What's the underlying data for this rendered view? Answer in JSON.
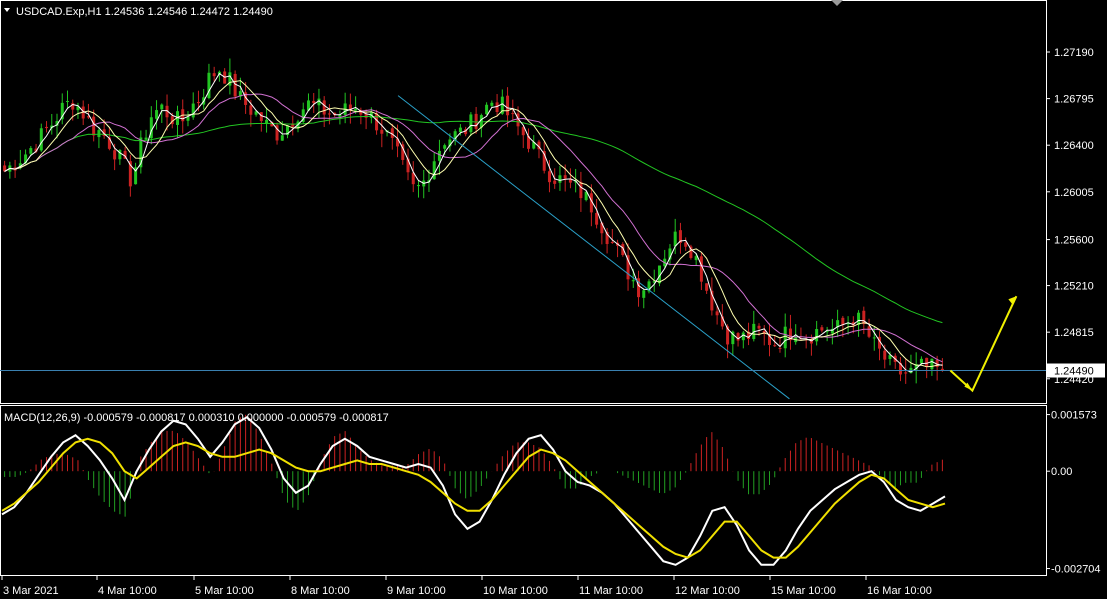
{
  "header": {
    "symbol_line": "USDCAD.Exp,H1  1.24536 1.24546 1.24472 1.24490"
  },
  "macd": {
    "label": "MACD(12,26,9) -0.000579 -0.000817 0.000310 0.000000 -0.000579 -0.000817"
  },
  "chart_data": [
    {
      "type": "candlestick",
      "title": "USDCAD.Exp,H1",
      "ohlc_current": {
        "open": 1.24536,
        "high": 1.24546,
        "low": 1.24472,
        "close": 1.2449
      },
      "y_ticks": [
        "1.27190",
        "1.26795",
        "1.26400",
        "1.26005",
        "1.25600",
        "1.25210",
        "1.24815",
        "1.24420"
      ],
      "y_tick_values": [
        1.2719,
        1.26795,
        1.264,
        1.26005,
        1.256,
        1.2521,
        1.24815,
        1.2442
      ],
      "ylim": [
        1.2424,
        1.2758
      ],
      "current_price_label": "1.24490",
      "current_price": 1.2449,
      "x_ticks": [
        "3 Mar 2021",
        "4 Mar 10:00",
        "5 Mar 10:00",
        "8 Mar 10:00",
        "9 Mar 10:00",
        "10 Mar 10:00",
        "11 Mar 10:00",
        "12 Mar 10:00",
        "15 Mar 10:00",
        "16 Mar 10:00"
      ],
      "close_path": [
        1.2618,
        1.2625,
        1.2632,
        1.264,
        1.265,
        1.266,
        1.2672,
        1.2678,
        1.2668,
        1.2655,
        1.265,
        1.264,
        1.2625,
        1.261,
        1.264,
        1.2665,
        1.2672,
        1.2665,
        1.2658,
        1.2672,
        1.268,
        1.2698,
        1.2705,
        1.2695,
        1.268,
        1.2672,
        1.2665,
        1.2655,
        1.265,
        1.2658,
        1.2668,
        1.2675,
        1.2672,
        1.2668,
        1.2665,
        1.267,
        1.2672,
        1.2668,
        1.266,
        1.265,
        1.2635,
        1.2615,
        1.26,
        1.261,
        1.263,
        1.2645,
        1.2648,
        1.2652,
        1.266,
        1.267,
        1.2678,
        1.2672,
        1.266,
        1.265,
        1.264,
        1.2625,
        1.2615,
        1.261,
        1.2605,
        1.26,
        1.259,
        1.2575,
        1.256,
        1.2545,
        1.253,
        1.2518,
        1.2525,
        1.254,
        1.2555,
        1.2565,
        1.2558,
        1.254,
        1.2515,
        1.2495,
        1.248,
        1.2475,
        1.2478,
        1.2482,
        1.2476,
        1.2472,
        1.248,
        1.2485,
        1.2478,
        1.2482,
        1.2485,
        1.2483,
        1.2488,
        1.2495,
        1.2485,
        1.247,
        1.246,
        1.245,
        1.2446,
        1.2448,
        1.2452,
        1.245,
        1.2449
      ],
      "trend_line": {
        "from": [
          1.2682,
          0.42
        ],
        "to": [
          1.2425,
          0.835
        ]
      },
      "projection": {
        "down_to": 1.2432,
        "up_to": 1.2512
      }
    },
    {
      "type": "line",
      "title": "MACD(12,26,9)",
      "y_ticks": [
        "0.001573",
        "0.00",
        "-0.002704"
      ],
      "y_tick_values": [
        0.001573,
        0.0,
        -0.002704
      ],
      "ylim": [
        -0.0028,
        0.0017
      ],
      "macd": [
        -0.0012,
        -0.001,
        -0.0006,
        -0.0001,
        0.0004,
        0.0008,
        0.001,
        0.0007,
        0.0003,
        -0.0002,
        -0.0008,
        0.0,
        0.0006,
        0.0011,
        0.0014,
        0.0013,
        0.0009,
        0.0004,
        0.0008,
        0.0013,
        0.0015,
        0.0012,
        0.0006,
        -0.0002,
        -0.0006,
        -0.0004,
        0.0002,
        0.0007,
        0.0009,
        0.0007,
        0.0004,
        0.0003,
        0.0002,
        0.0001,
        0.0002,
        0.0001,
        -0.0004,
        -0.0012,
        -0.0016,
        -0.0014,
        -0.0008,
        -0.0001,
        0.0005,
        0.0009,
        0.001,
        0.0006,
        0.0,
        -0.0003,
        -0.0004,
        -0.0006,
        -0.0009,
        -0.0013,
        -0.0017,
        -0.0021,
        -0.0025,
        -0.0026,
        -0.0024,
        -0.0018,
        -0.0011,
        -0.001,
        -0.0015,
        -0.0022,
        -0.0026,
        -0.0026,
        -0.0022,
        -0.0016,
        -0.0011,
        -0.0008,
        -0.0005,
        -0.0003,
        -0.0001,
        0.0,
        -0.0003,
        -0.0008,
        -0.001,
        -0.0011,
        -0.0009,
        -0.0007
      ],
      "signal": [
        -0.0011,
        -0.0009,
        -0.0006,
        -0.0003,
        0.0001,
        0.0005,
        0.0008,
        0.0009,
        0.0008,
        0.0005,
        0.0,
        -0.0002,
        0.0001,
        0.0004,
        0.0007,
        0.0008,
        0.0007,
        0.0005,
        0.0004,
        0.0004,
        0.0005,
        0.0006,
        0.0005,
        0.0003,
        0.0001,
        0.0,
        0.0,
        0.0001,
        0.0002,
        0.0003,
        0.0002,
        0.0002,
        0.0001,
        0.0,
        -0.0001,
        -0.0003,
        -0.0006,
        -0.0009,
        -0.0011,
        -0.0011,
        -0.0008,
        -0.0004,
        0.0,
        0.0004,
        0.0006,
        0.0005,
        0.0003,
        0.0,
        -0.0003,
        -0.0006,
        -0.0009,
        -0.0012,
        -0.0015,
        -0.0018,
        -0.0021,
        -0.0023,
        -0.0024,
        -0.0022,
        -0.0018,
        -0.0014,
        -0.0014,
        -0.0018,
        -0.0022,
        -0.0024,
        -0.0024,
        -0.0021,
        -0.0017,
        -0.0013,
        -0.0009,
        -0.0006,
        -0.0003,
        -0.0001,
        -0.0002,
        -0.0005,
        -0.0008,
        -0.0009,
        -0.001,
        -0.0009
      ]
    }
  ],
  "colors": {
    "background": "#000000",
    "bull_candle": "#22c522",
    "bear_candle": "#cc2222",
    "ma_fast": "#ffffff",
    "ma_mid": "#ffffb0",
    "ma_slow": "#d070d0",
    "ma_long": "#22c522",
    "trend_line": "#2aa0c8",
    "price_line": "#3a80b0",
    "projection_arrow": "#f0f000",
    "macd_line": "#ffffff",
    "signal_line": "#f0e000",
    "hist_pos": "#cc2222",
    "hist_neg": "#22a022",
    "grid": "#ffffff"
  }
}
